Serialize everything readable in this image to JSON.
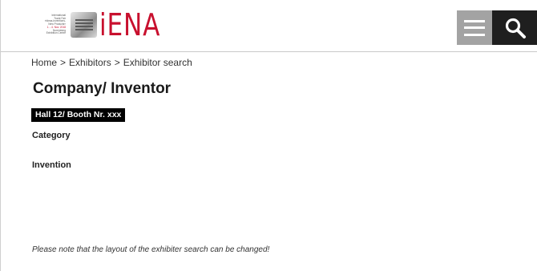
{
  "header": {
    "logo": {
      "fair_lines": [
        "International",
        "Trade Fair",
        "»Ideas-Inventions-",
        "New Products«",
        "1. - 4. Nov. 2018",
        "Nuremberg",
        "Exhibition Centre"
      ],
      "wordmark": "iENA",
      "brand_color": "#c8102e"
    },
    "menu_icon": "hamburger-icon",
    "search_icon": "search-icon",
    "menu_bg": "#a3a3a3",
    "search_bg": "#1f1f1f"
  },
  "breadcrumb": {
    "items": [
      "Home",
      "Exhibitors",
      "Exhibitor search"
    ],
    "separator": ">"
  },
  "main": {
    "title": "Company/ Inventor",
    "booth": "Hall 12/ Booth Nr. xxx",
    "category_label": "Category",
    "invention_label": "Invention",
    "note": "Please note that the layout of the exhibiter search can be changed!"
  }
}
